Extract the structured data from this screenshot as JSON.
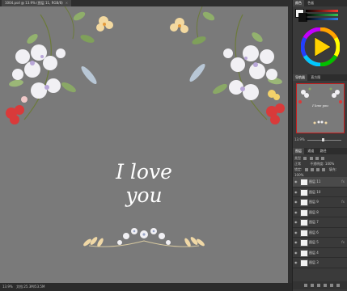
{
  "document": {
    "tab_title": "1004.psd @ 13.9% (图层 11, RGB/8)",
    "tab_close": "×"
  },
  "canvas": {
    "headline": "I love you",
    "background": "#7a7a7a"
  },
  "status_bar": {
    "zoom": "13.9%",
    "doc_size": "文档:25.3M/53.5M"
  },
  "color_panel": {
    "tabs": [
      "颜色",
      "色板"
    ],
    "foreground": "#f5f5f5",
    "background": "#111111",
    "r_slider": "#ff3b30",
    "g_slider": "#34c759",
    "b_slider": "#2f80ed",
    "indicator": "#ffd200",
    "icon": "color-wheel-icon"
  },
  "navigator_panel": {
    "tabs": [
      "导航器",
      "直方图"
    ],
    "thumb_text": "I love you",
    "zoom": "13.9%"
  },
  "layers_panel": {
    "tabs": [
      "图层",
      "通道",
      "路径"
    ],
    "kind_label": "类型",
    "blend_mode": "正常",
    "opacity_label": "不透明度:",
    "opacity": "100%",
    "lock_label": "锁定:",
    "fill_label": "填充:",
    "fill": "100%",
    "layers": [
      {
        "name": "图层 11",
        "fx": true
      },
      {
        "name": "图层 10",
        "fx": false
      },
      {
        "name": "图层 9",
        "fx": true
      },
      {
        "name": "图层 8",
        "fx": false
      },
      {
        "name": "图层 7",
        "fx": false
      },
      {
        "name": "图层 6",
        "fx": false
      },
      {
        "name": "图层 5",
        "fx": true
      },
      {
        "name": "图层 4",
        "fx": false
      },
      {
        "name": "图层 3",
        "fx": false
      }
    ]
  }
}
